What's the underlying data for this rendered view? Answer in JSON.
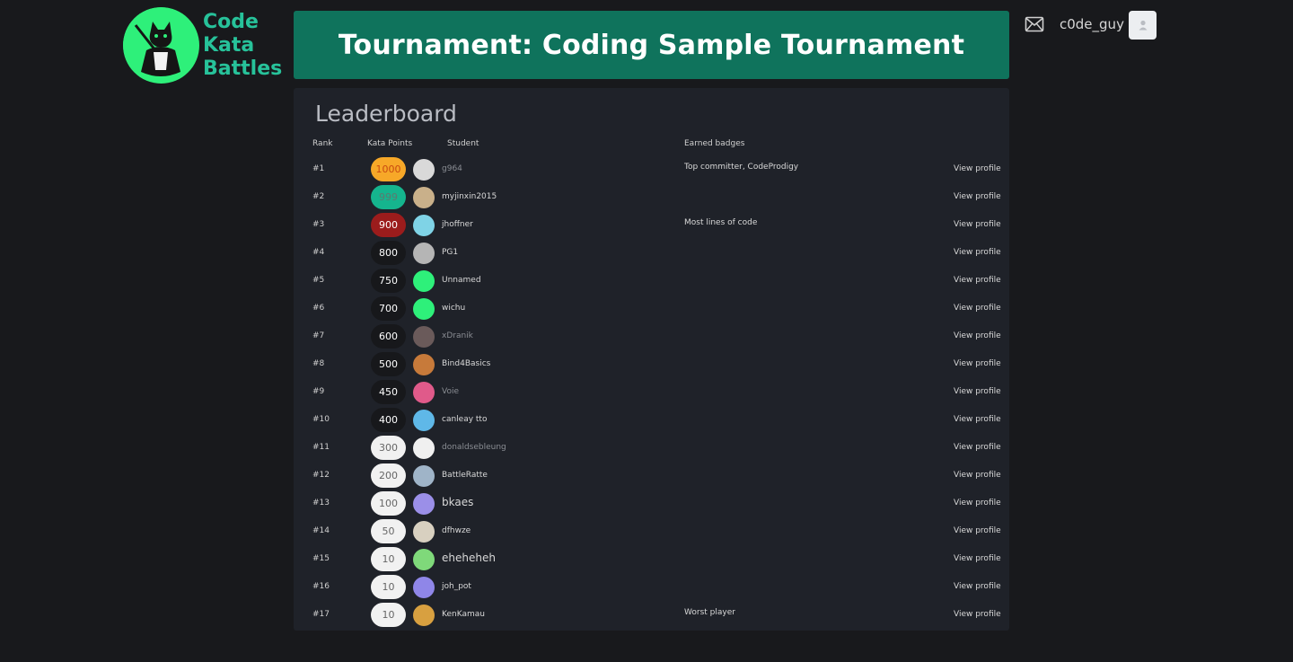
{
  "brand": {
    "line1": "Code",
    "line2": "Kata",
    "line3": "Battles"
  },
  "header": {
    "title": "Tournament: Coding Sample Tournament"
  },
  "user": {
    "name": "c0de_guy"
  },
  "leaderboard": {
    "title": "Leaderboard",
    "columns": {
      "rank": "Rank",
      "points": "Kata Points",
      "student": "Student",
      "badges": "Earned badges"
    },
    "view_label": "View profile",
    "rows": [
      {
        "rank": "#1",
        "points": "1000",
        "student": "g964",
        "badges": "Top committer,  CodeProdigy",
        "style": "gold",
        "avatar_color": "#d9d9d9"
      },
      {
        "rank": "#2",
        "points": "999",
        "student": "myjinxin2015",
        "badges": "",
        "style": "teal",
        "avatar_color": "#c9b08a"
      },
      {
        "rank": "#3",
        "points": "900",
        "student": "jhoffner",
        "badges": "Most lines of code",
        "style": "red",
        "avatar_color": "#7fd3e6"
      },
      {
        "rank": "#4",
        "points": "800",
        "student": "PG1",
        "badges": "",
        "style": "dark",
        "avatar_color": "#b5b5b5"
      },
      {
        "rank": "#5",
        "points": "750",
        "student": "Unnamed",
        "badges": "",
        "style": "dark",
        "avatar_color": "#2ef07a"
      },
      {
        "rank": "#6",
        "points": "700",
        "student": "wichu",
        "badges": "",
        "style": "dark",
        "avatar_color": "#2ef07a"
      },
      {
        "rank": "#7",
        "points": "600",
        "student": "xDranik",
        "badges": "",
        "style": "dark",
        "avatar_color": "#6a5a5a"
      },
      {
        "rank": "#8",
        "points": "500",
        "student": "Bind4Basics",
        "badges": "",
        "style": "dark",
        "avatar_color": "#c77a3a"
      },
      {
        "rank": "#9",
        "points": "450",
        "student": "Voie",
        "badges": "",
        "style": "dark",
        "avatar_color": "#e05a8a"
      },
      {
        "rank": "#10",
        "points": "400",
        "student": "canleay tto",
        "badges": "",
        "style": "dark",
        "avatar_color": "#5fb8e8"
      },
      {
        "rank": "#11",
        "points": "300",
        "student": "donaldsebleung",
        "badges": "",
        "style": "light",
        "avatar_color": "#f0f0f0"
      },
      {
        "rank": "#12",
        "points": "200",
        "student": "BattleRatte",
        "badges": "",
        "style": "light",
        "avatar_color": "#9fb4c8"
      },
      {
        "rank": "#13",
        "points": "100",
        "student": "bkaes",
        "badges": "",
        "style": "light",
        "avatar_color": "#9b8fe8"
      },
      {
        "rank": "#14",
        "points": "50",
        "student": "dfhwze",
        "badges": "",
        "style": "light",
        "avatar_color": "#d8d0c0"
      },
      {
        "rank": "#15",
        "points": "10",
        "student": "eheheheh",
        "badges": "",
        "style": "light",
        "avatar_color": "#7fd97a"
      },
      {
        "rank": "#16",
        "points": "10",
        "student": "joh_pot",
        "badges": "",
        "style": "light",
        "avatar_color": "#8f86e8"
      },
      {
        "rank": "#17",
        "points": "10",
        "student": "KenKamau",
        "badges": "Worst player",
        "style": "light",
        "avatar_color": "#d8a040"
      }
    ]
  },
  "icons": {
    "mail": "mail-icon",
    "avatar": "user-avatar-icon",
    "logo": "ninja-cat-logo"
  }
}
